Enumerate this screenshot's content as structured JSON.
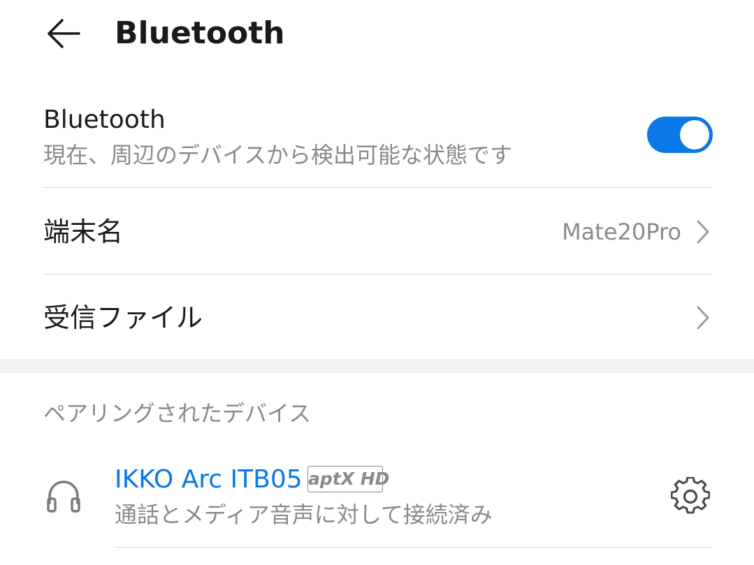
{
  "header": {
    "back_icon": "arrow-left-icon",
    "title": "Bluetooth"
  },
  "bluetooth": {
    "label": "Bluetooth",
    "status": "現在、周辺のデバイスから検出可能な状態です",
    "enabled": true,
    "toggle_color": "#0a78e6"
  },
  "settings": {
    "device_name": {
      "label": "端末名",
      "value": "Mate20Pro",
      "icon": "chevron-right-icon"
    },
    "received_files": {
      "label": "受信ファイル",
      "icon": "chevron-right-icon"
    }
  },
  "paired_devices": {
    "header": "ペアリングされたデバイス",
    "items": [
      {
        "name": "IKKO Arc ITB05",
        "codec": "aptX HD",
        "status": "通話とメディア音声に対して接続済み",
        "icon": "headset-icon",
        "action_icon": "gear-icon",
        "name_color": "#0a78e6"
      }
    ]
  }
}
